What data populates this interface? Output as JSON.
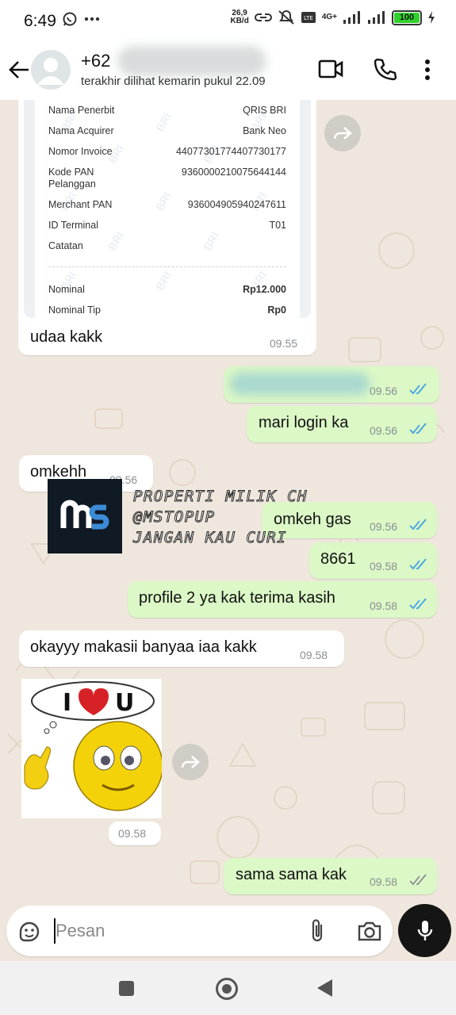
{
  "status_bar": {
    "time": "6:49",
    "net_speed_value": "26,9",
    "net_speed_unit": "KB/d",
    "network": "4G+",
    "battery": "100"
  },
  "header": {
    "contact_name": "+62",
    "last_seen": "terakhir dilihat kemarin pukul 22.09"
  },
  "receipt": {
    "rows": [
      {
        "label": "Nama Penerbit",
        "value": "QRIS BRI"
      },
      {
        "label": "Nama Acquirer",
        "value": "Bank Neo"
      },
      {
        "label": "Nomor Invoice",
        "value": "44077301774407730177"
      },
      {
        "label": "Kode PAN",
        "label2": "Pelanggan",
        "value": "9360000210075644144"
      },
      {
        "label": "Merchant PAN",
        "value": "936004905940247611"
      },
      {
        "label": "ID Terminal",
        "value": "T01"
      },
      {
        "label": "Catatan",
        "value": ""
      },
      {
        "label": "Nominal",
        "value": "Rp12.000"
      },
      {
        "label": "Nominal Tip",
        "value": "Rp0"
      }
    ]
  },
  "messages": [
    {
      "text": "udaa kakk",
      "time": "09.55",
      "dir": "in"
    },
    {
      "text": "",
      "time": "09.56",
      "dir": "out"
    },
    {
      "text": "mari login ka",
      "time": "09.56",
      "dir": "out"
    },
    {
      "text": "omkehh",
      "time": "09.56",
      "dir": "in"
    },
    {
      "text": "omkeh gas",
      "time": "09.56",
      "dir": "out"
    },
    {
      "text": "8661",
      "time": "09.58",
      "dir": "out"
    },
    {
      "text": "profile 2 ya kak terima kasih",
      "time": "09.58",
      "dir": "out"
    },
    {
      "text": "okayyy makasii banyaa iaa kakk",
      "time": "09.58",
      "dir": "in"
    },
    {
      "text": "",
      "time": "09.58",
      "dir": "in"
    },
    {
      "text": "sama sama kak",
      "time": "09.58",
      "dir": "out"
    }
  ],
  "overlay": {
    "line1": "PROPERTI MILIK CH",
    "line2": "@MSTOPUP",
    "line3": "JANGAN KAU CURI",
    "logo_text": "MS"
  },
  "sticker": {
    "letter_i": "I",
    "letter_u": "U"
  },
  "composer": {
    "placeholder": "Pesan"
  },
  "colors": {
    "outgoing_bubble": "#dbf8c6",
    "incoming_bubble": "#ffffff",
    "read_ticks": "#3fa3e6",
    "chat_background": "#efe7dd"
  }
}
